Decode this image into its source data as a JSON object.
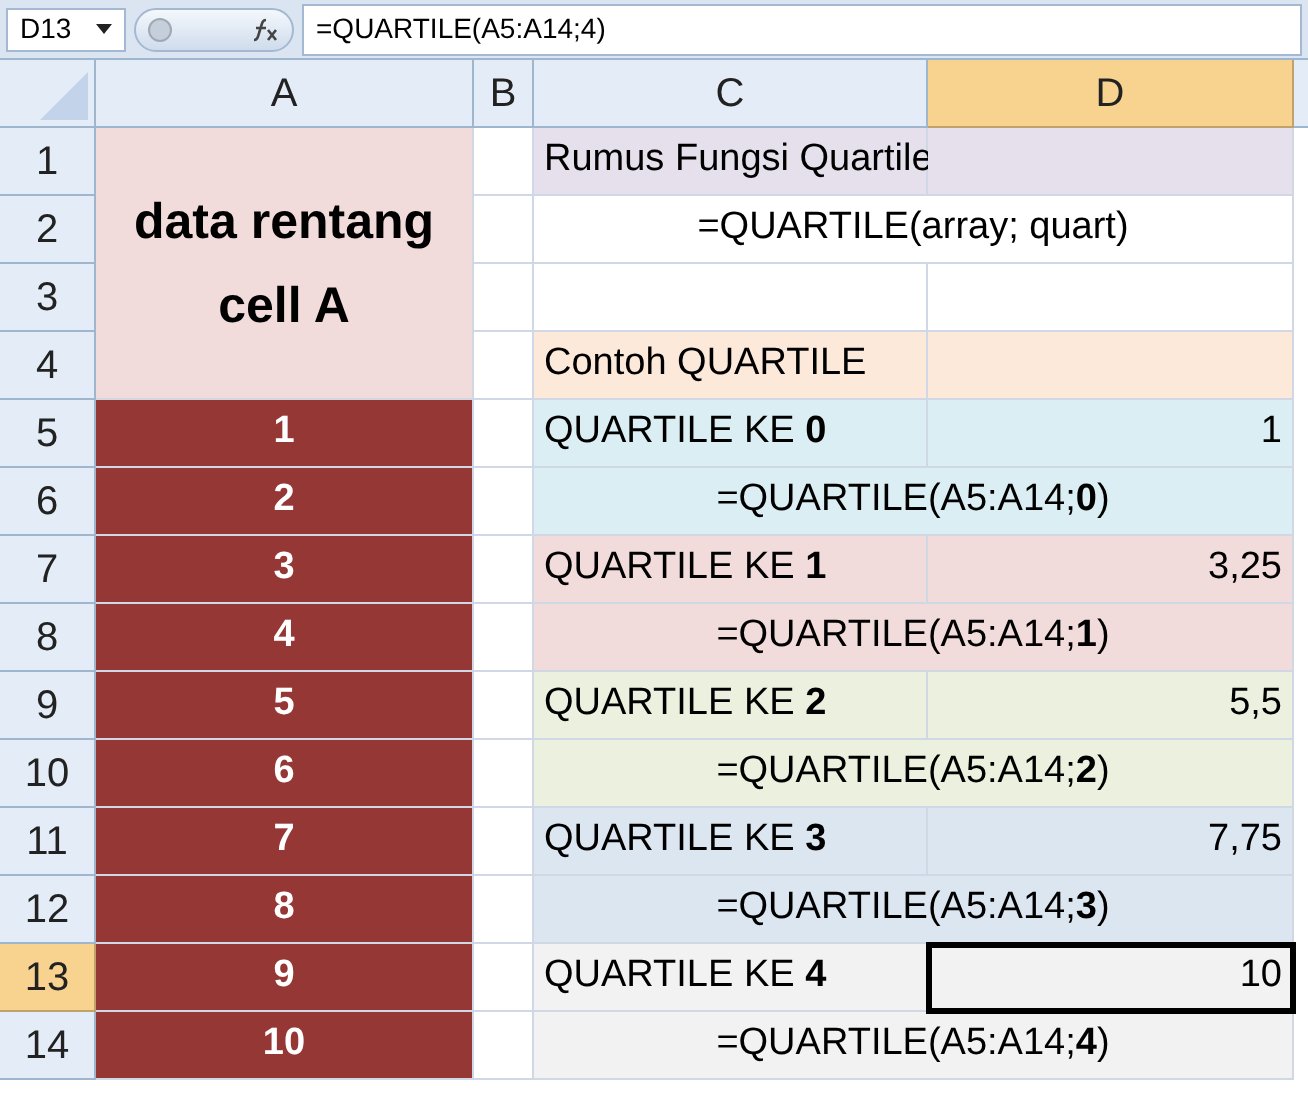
{
  "formula_bar": {
    "name_box": "D13",
    "formula": "=QUARTILE(A5:A14;4)"
  },
  "columns": [
    {
      "label": "A",
      "selected": false
    },
    {
      "label": "B",
      "selected": false
    },
    {
      "label": "C",
      "selected": false
    },
    {
      "label": "D",
      "selected": true
    }
  ],
  "rows": [
    {
      "label": "1",
      "selected": false
    },
    {
      "label": "2",
      "selected": false
    },
    {
      "label": "3",
      "selected": false
    },
    {
      "label": "4",
      "selected": false
    },
    {
      "label": "5",
      "selected": false
    },
    {
      "label": "6",
      "selected": false
    },
    {
      "label": "7",
      "selected": false
    },
    {
      "label": "8",
      "selected": false
    },
    {
      "label": "9",
      "selected": false
    },
    {
      "label": "10",
      "selected": false
    },
    {
      "label": "11",
      "selected": false
    },
    {
      "label": "12",
      "selected": false
    },
    {
      "label": "13",
      "selected": true
    },
    {
      "label": "14",
      "selected": false
    }
  ],
  "data_heading": "data rentang cell A",
  "data_values": [
    "1",
    "2",
    "3",
    "4",
    "5",
    "6",
    "7",
    "8",
    "9",
    "10"
  ],
  "title": "Rumus Fungsi Quartile",
  "syntax": "=QUARTILE(array; quart)",
  "example_heading": "Contoh QUARTILE",
  "quartiles": [
    {
      "label": "QUARTILE KE **0**",
      "result": "1",
      "formula": "=QUARTILE(A5:A14;**0**)",
      "color": "#dbeef3",
      "selected": false
    },
    {
      "label": "QUARTILE KE **1**",
      "result": "3,25",
      "formula": "=QUARTILE(A5:A14;**1**)",
      "color": "#f2dcdb",
      "selected": false
    },
    {
      "label": "QUARTILE KE **2**",
      "result": "5,5",
      "formula": "=QUARTILE(A5:A14;**2**)",
      "color": "#ebf1de",
      "selected": false
    },
    {
      "label": "QUARTILE KE **3**",
      "result": "7,75",
      "formula": "=QUARTILE(A5:A14;**3**)",
      "color": "#dce6f1",
      "selected": false
    },
    {
      "label": "QUARTILE KE **4**",
      "result": "10",
      "formula": "=QUARTILE(A5:A14;**4**)",
      "color": "#f2f2f2",
      "selected": true
    }
  ]
}
